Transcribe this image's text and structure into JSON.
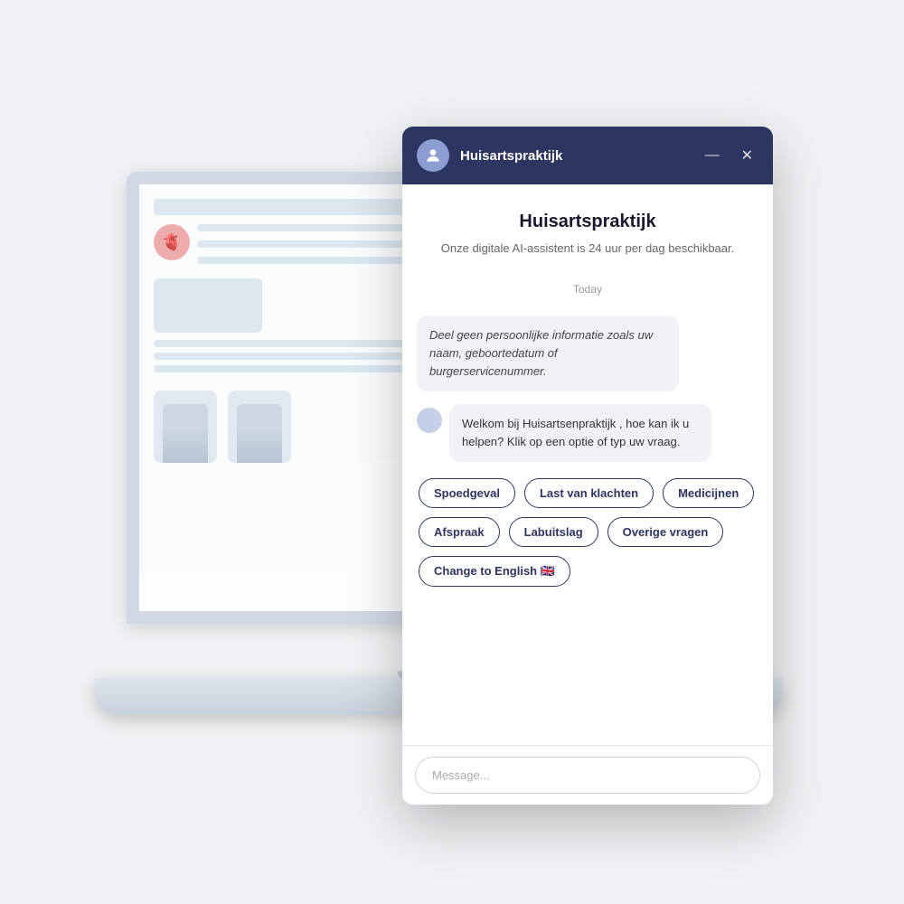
{
  "background": "#f0f2f5",
  "chat": {
    "header": {
      "title": "Huisartspraktijk",
      "minimize_label": "—",
      "close_label": "✕",
      "avatar_icon": "👤"
    },
    "intro": {
      "title": "Huisartspraktijk",
      "subtitle": "Onze digitale AI-assistent is 24 uur per dag beschikbaar."
    },
    "date_label": "Today",
    "messages": [
      {
        "type": "bot",
        "text": "Deel geen persoonlijke informatie zoals uw naam, geboortedatum of burgerservicenummer.",
        "italic": true
      },
      {
        "type": "bot",
        "text": "Welkom bij Huisartsenpraktijk , hoe kan ik u helpen? Klik op een optie of typ uw vraag.",
        "italic": false
      }
    ],
    "quick_buttons": [
      {
        "label": "Spoedgeval"
      },
      {
        "label": "Last van klachten"
      },
      {
        "label": "Medicijnen"
      },
      {
        "label": "Afspraak"
      },
      {
        "label": "Labuitslag"
      },
      {
        "label": "Overige vragen"
      },
      {
        "label": "Change to English 🇬🇧"
      }
    ],
    "input": {
      "placeholder": "Message..."
    }
  },
  "laptop": {
    "logo_emoji": "🫀"
  }
}
